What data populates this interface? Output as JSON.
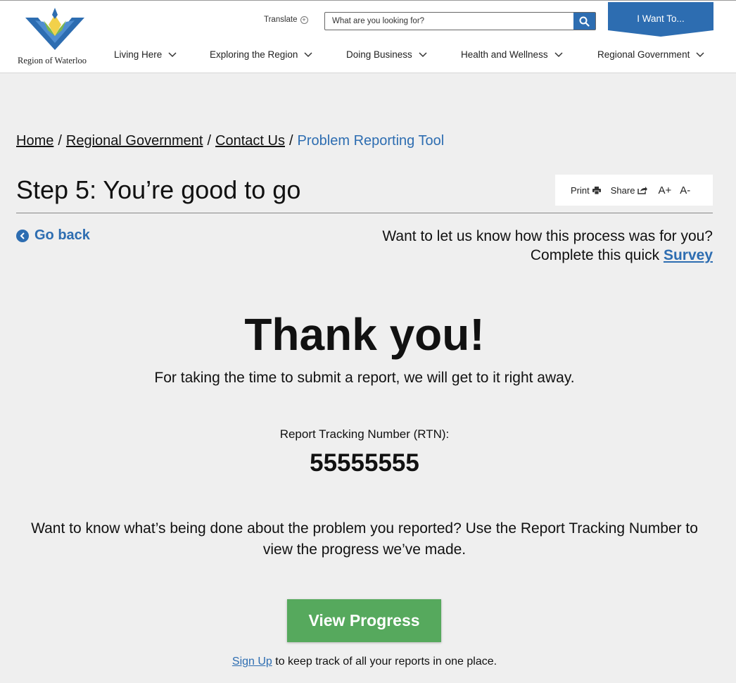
{
  "header": {
    "logo_text": "Region of Waterloo",
    "translate_label": "Translate",
    "search_placeholder": "What are you looking for?",
    "i_want_label": "I Want To...",
    "nav": [
      {
        "label": "Living Here"
      },
      {
        "label": "Exploring the Region"
      },
      {
        "label": "Doing Business"
      },
      {
        "label": "Health and Wellness"
      },
      {
        "label": "Regional Government"
      }
    ]
  },
  "breadcrumb": {
    "items": [
      "Home",
      "Regional Government",
      "Contact Us"
    ],
    "separator": "/",
    "current": "Problem Reporting Tool"
  },
  "page": {
    "title": "Step 5: You’re good to go",
    "tools": {
      "print": "Print",
      "share": "Share",
      "font_up": "A+",
      "font_down": "A-"
    },
    "go_back": "Go back",
    "survey_line1": "Want to let us know how this process was for you?",
    "survey_line2": "Complete this quick",
    "survey_link": "Survey"
  },
  "confirmation": {
    "heading": "Thank you!",
    "subtext": "For taking the time to submit a report, we will get to it right away.",
    "rtn_label": "Report Tracking Number (RTN):",
    "rtn_value": "55555555",
    "progress_text": "Want to know what’s being done about the problem you reported? Use the Report Tracking Number to view the progress we’ve made.",
    "view_progress": "View Progress",
    "signup_link": "Sign Up",
    "signup_text": " to keep track of all your reports in one place."
  },
  "colors": {
    "primary_blue": "#2d6db1",
    "button_green": "#56a95d",
    "background": "#efefef"
  }
}
